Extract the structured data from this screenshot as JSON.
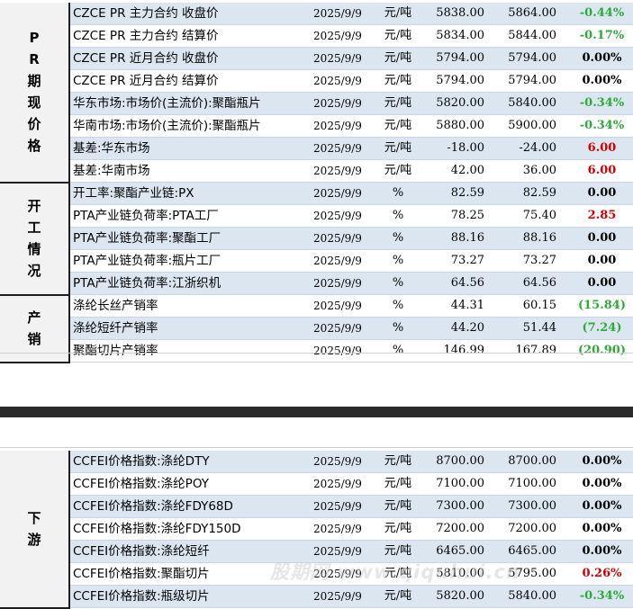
{
  "top_table": {
    "sections": [
      {
        "category": "PR期现价格",
        "rows": [
          {
            "name": "CZCE PR 主力合约 收盘价",
            "date": "2025/9/9",
            "unit": "元/吨",
            "v1": "5838.00",
            "v2": "5864.00",
            "change": "-0.44%",
            "color": "green"
          },
          {
            "name": "CZCE PR 主力合约 结算价",
            "date": "2025/9/9",
            "unit": "元/吨",
            "v1": "5834.00",
            "v2": "5844.00",
            "change": "-0.17%",
            "color": "green"
          },
          {
            "name": "CZCE PR 近月合约 收盘价",
            "date": "2025/9/9",
            "unit": "元/吨",
            "v1": "5794.00",
            "v2": "5794.00",
            "change": "0.00%",
            "color": "black"
          },
          {
            "name": "CZCE PR 近月合约 结算价",
            "date": "2025/9/9",
            "unit": "元/吨",
            "v1": "5794.00",
            "v2": "5794.00",
            "change": "0.00%",
            "color": "black"
          },
          {
            "name": "华东市场:市场价(主流价):聚酯瓶片",
            "date": "2025/9/9",
            "unit": "元/吨",
            "v1": "5820.00",
            "v2": "5840.00",
            "change": "-0.34%",
            "color": "green"
          },
          {
            "name": "华南市场:市场价(主流价):聚酯瓶片",
            "date": "2025/9/9",
            "unit": "元/吨",
            "v1": "5880.00",
            "v2": "5900.00",
            "change": "-0.34%",
            "color": "green"
          },
          {
            "name": "基差:华东市场",
            "date": "2025/9/9",
            "unit": "元/吨",
            "v1": "-18.00",
            "v2": "-24.00",
            "change": "6.00",
            "color": "red"
          },
          {
            "name": "基差:华南市场",
            "date": "2025/9/9",
            "unit": "元/吨",
            "v1": "42.00",
            "v2": "36.00",
            "change": "6.00",
            "color": "red"
          }
        ]
      },
      {
        "category": "开工情况",
        "rows": [
          {
            "name": "开工率:聚酯产业链:PX",
            "date": "2025/9/9",
            "unit": "%",
            "v1": "82.59",
            "v2": "82.59",
            "change": "0.00",
            "color": "black"
          },
          {
            "name": "PTA产业链负荷率:PTA工厂",
            "date": "2025/9/9",
            "unit": "%",
            "v1": "78.25",
            "v2": "75.40",
            "change": "2.85",
            "color": "red"
          },
          {
            "name": "PTA产业链负荷率:聚酯工厂",
            "date": "2025/9/9",
            "unit": "%",
            "v1": "88.16",
            "v2": "88.16",
            "change": "0.00",
            "color": "black"
          },
          {
            "name": "PTA产业链负荷率:瓶片工厂",
            "date": "2025/9/9",
            "unit": "%",
            "v1": "73.27",
            "v2": "73.27",
            "change": "0.00",
            "color": "black"
          },
          {
            "name": "PTA产业链负荷率:江浙织机",
            "date": "2025/9/9",
            "unit": "%",
            "v1": "64.56",
            "v2": "64.56",
            "change": "0.00",
            "color": "black"
          }
        ]
      },
      {
        "category": "产销",
        "rows": [
          {
            "name": "涤纶长丝产销率",
            "date": "2025/9/9",
            "unit": "%",
            "v1": "44.31",
            "v2": "60.15",
            "change": "(15.84)",
            "color": "green"
          },
          {
            "name": "涤纶短纤产销率",
            "date": "2025/9/9",
            "unit": "%",
            "v1": "44.20",
            "v2": "51.44",
            "change": "(7.24)",
            "color": "green"
          },
          {
            "name": "聚酯切片产销率",
            "date": "2025/9/9",
            "unit": "%",
            "v1": "146.99",
            "v2": "167.89",
            "change": "(20.90)",
            "color": "green"
          }
        ]
      }
    ]
  },
  "bottom_table": {
    "sections": [
      {
        "category": "下游",
        "rows": [
          {
            "name": "CCFEI价格指数:涤纶DTY",
            "date": "2025/9/9",
            "unit": "元/吨",
            "v1": "8700.00",
            "v2": "8700.00",
            "change": "0.00%",
            "color": "black"
          },
          {
            "name": "CCFEI价格指数:涤纶POY",
            "date": "2025/9/9",
            "unit": "元/吨",
            "v1": "7100.00",
            "v2": "7100.00",
            "change": "0.00%",
            "color": "black"
          },
          {
            "name": "CCFEI价格指数:涤纶FDY68D",
            "date": "2025/9/9",
            "unit": "元/吨",
            "v1": "7300.00",
            "v2": "7300.00",
            "change": "0.00%",
            "color": "black"
          },
          {
            "name": "CCFEI价格指数:涤纶FDY150D",
            "date": "2025/9/9",
            "unit": "元/吨",
            "v1": "7200.00",
            "v2": "7200.00",
            "change": "0.00%",
            "color": "black"
          },
          {
            "name": "CCFEI价格指数:涤纶短纤",
            "date": "2025/9/9",
            "unit": "元/吨",
            "v1": "6465.00",
            "v2": "6465.00",
            "change": "0.00%",
            "color": "black"
          },
          {
            "name": "CCFEI价格指数:聚酯切片",
            "date": "2025/9/9",
            "unit": "元/吨",
            "v1": "5810.00",
            "v2": "5795.00",
            "change": "0.26%",
            "color": "red"
          },
          {
            "name": "CCFEI价格指数:瓶级切片",
            "date": "2025/9/9",
            "unit": "元/吨",
            "v1": "5820.00",
            "v2": "5840.00",
            "change": "-0.34%",
            "color": "green"
          }
        ]
      }
    ]
  },
  "watermark": "股期网 www.qiquhui.cn",
  "colors": {
    "up": "#d10000",
    "down": "#2eaa38",
    "row_alt": "#dce6f1",
    "category_bg": "#f2f2f2",
    "band": "#2b2b2b"
  }
}
